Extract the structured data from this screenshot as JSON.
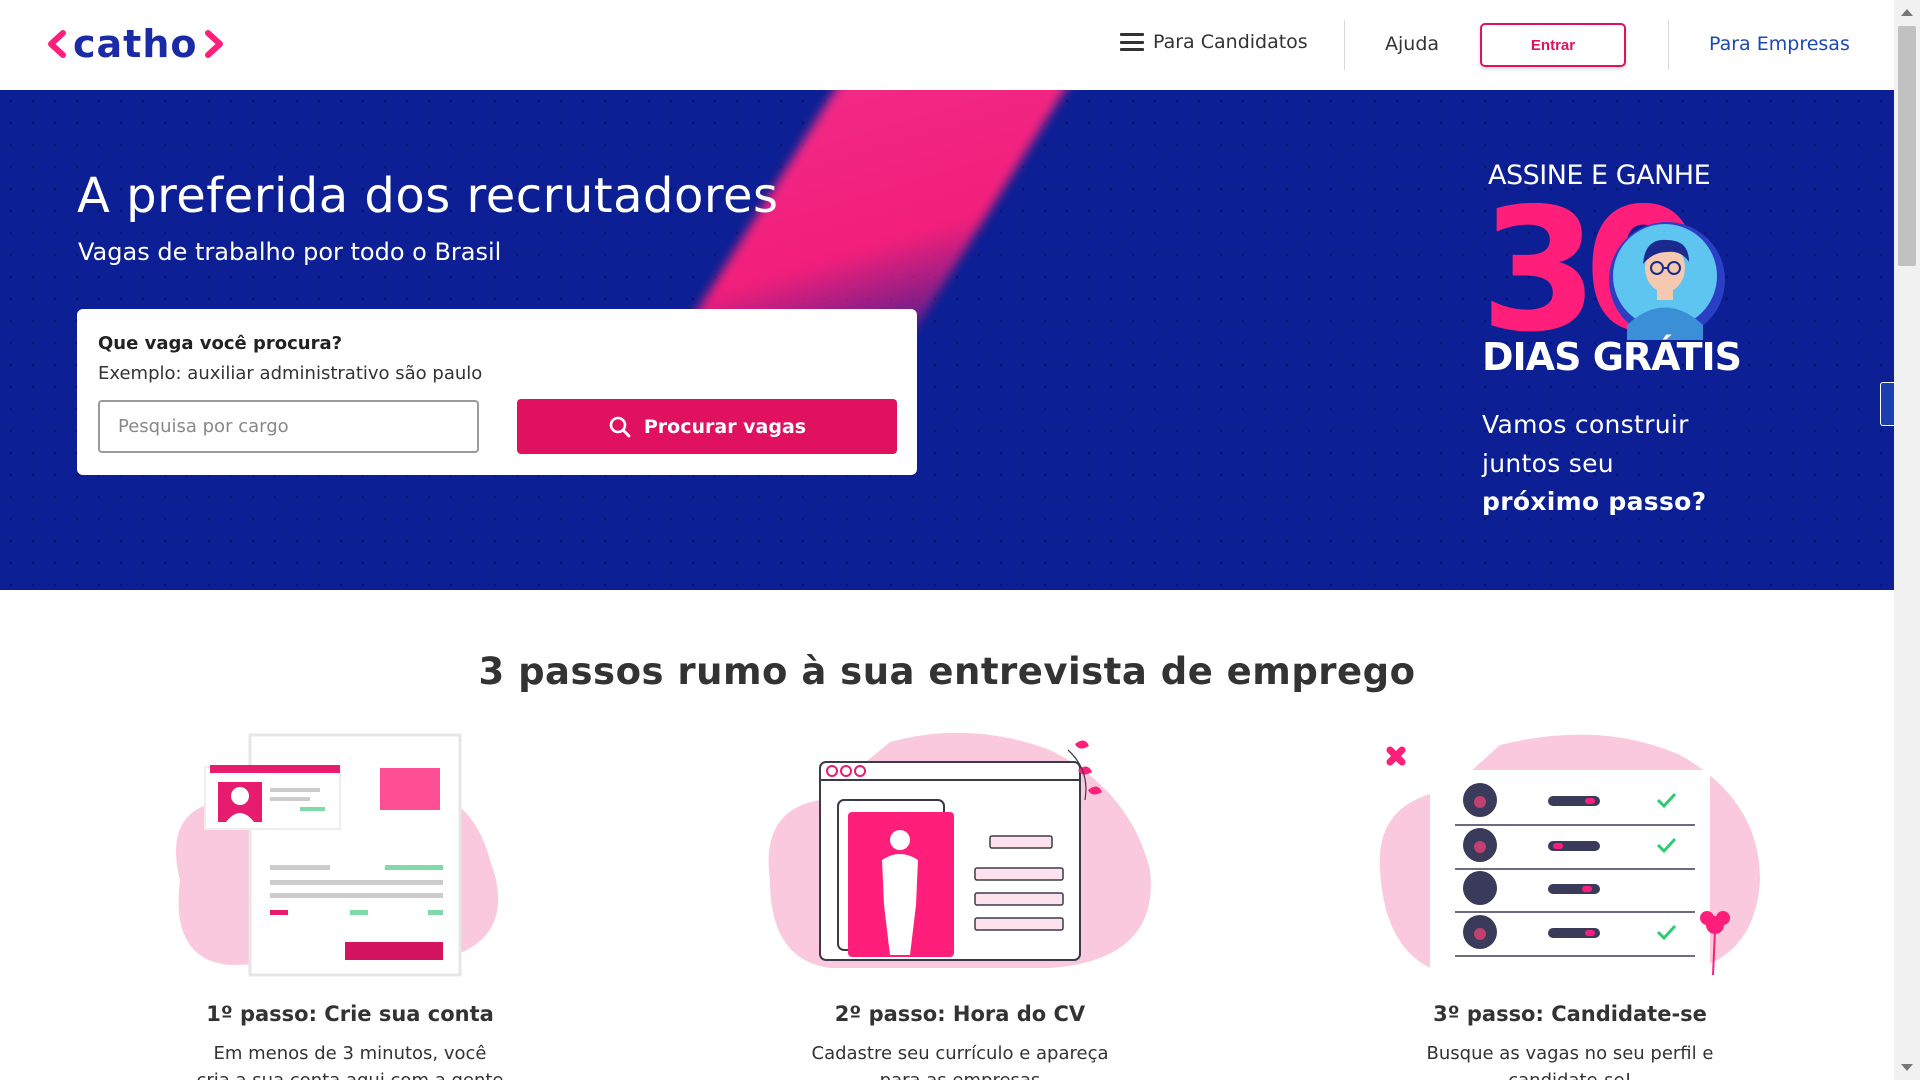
{
  "header": {
    "logo_text": "catho",
    "nav_candidates": "Para Candidatos",
    "nav_help": "Ajuda",
    "login_button": "Entrar",
    "nav_companies": "Para Empresas"
  },
  "hero": {
    "title": "A preferida dos recrutadores",
    "subtitle": "Vagas de trabalho por todo o Brasil",
    "search": {
      "question": "Que vaga você procura?",
      "example": "Exemplo: auxiliar administrativo são paulo",
      "placeholder": "Pesquisa por cargo",
      "button": "Procurar vagas"
    },
    "promo": {
      "top": "ASSINE E GANHE",
      "number": "30",
      "days": "DIAS GRÁTIS",
      "line1": "Vamos construir",
      "line2": "juntos seu",
      "line3": "próximo passo?"
    }
  },
  "steps": {
    "title": "3 passos rumo à sua entrevista de emprego",
    "items": [
      {
        "title": "1º passo: Crie sua conta",
        "desc1": "Em menos de 3 minutos, você",
        "desc2": "cria a sua conta aqui com a gente"
      },
      {
        "title": "2º passo: Hora do CV",
        "desc1": "Cadastre seu currículo e apareça",
        "desc2": "para as empresas"
      },
      {
        "title": "3º passo: Candidate-se",
        "desc1": "Busque as vagas no seu perfil e",
        "desc2": "candidate-se!"
      }
    ]
  },
  "colors": {
    "brand_blue": "#0c1f94",
    "brand_pink": "#e0115f",
    "link_blue": "#1b48b8"
  }
}
